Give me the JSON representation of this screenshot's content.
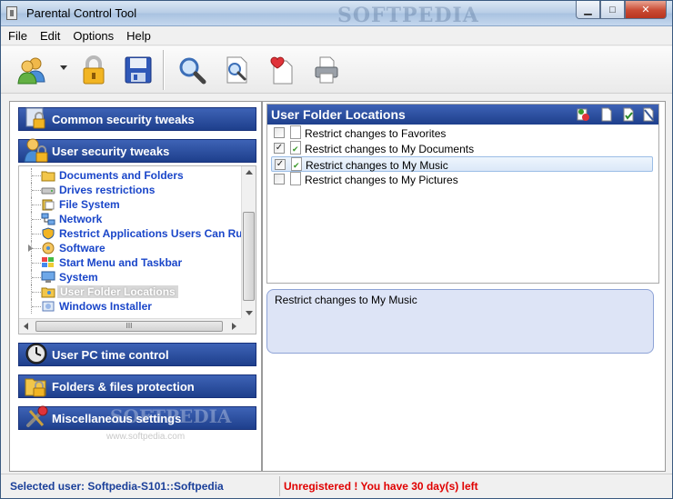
{
  "window": {
    "title": "Parental Control Tool",
    "watermark": "SOFTPEDIA",
    "minimize_glyph": "▁",
    "maximize_glyph": "□",
    "close_glyph": "✕"
  },
  "menu": [
    "File",
    "Edit",
    "Options",
    "Help"
  ],
  "toolbar": {
    "buttons": [
      {
        "icon": "users-icon"
      },
      {
        "icon": "lock-icon"
      },
      {
        "icon": "save-icon"
      },
      {
        "icon": "search-icon"
      },
      {
        "icon": "search-document-icon"
      },
      {
        "icon": "favorite-document-icon"
      },
      {
        "icon": "print-icon"
      }
    ]
  },
  "left_panel": {
    "categories": [
      {
        "label": "Common security tweaks",
        "icon": "lock-icon"
      },
      {
        "label": "User security tweaks",
        "icon": "user-lock-icon"
      },
      {
        "label": "User PC time control",
        "icon": "clock-icon"
      },
      {
        "label": "Folders & files protection",
        "icon": "folder-lock-icon"
      },
      {
        "label": "Miscellaneous settings",
        "icon": "tools-icon"
      }
    ],
    "tree_items": [
      {
        "label": "Documents and Folders",
        "icon": "folder-icon"
      },
      {
        "label": "Drives restrictions",
        "icon": "drive-icon"
      },
      {
        "label": "File System",
        "icon": "file-system-icon"
      },
      {
        "label": "Network",
        "icon": "network-icon"
      },
      {
        "label": "Restrict Applications Users Can Ru",
        "icon": "shield-icon"
      },
      {
        "label": "Software",
        "icon": "software-icon"
      },
      {
        "label": "Start Menu and Taskbar",
        "icon": "start-menu-icon"
      },
      {
        "label": "System",
        "icon": "system-icon"
      },
      {
        "label": "User Folder Locations",
        "icon": "user-folder-icon",
        "selected": true
      },
      {
        "label": "Windows Installer",
        "icon": "installer-icon"
      }
    ],
    "hscroll_grip": "III",
    "watermark": "SOFTPEDIA",
    "watermark_url": "www.softpedia.com"
  },
  "right_panel": {
    "title": "User Folder Locations",
    "header_icons": [
      "add-icon",
      "page-icon",
      "check-all-icon",
      "uncheck-all-icon"
    ],
    "items": [
      {
        "label": "Restrict changes to Favorites",
        "checked": false,
        "doc_checked": false
      },
      {
        "label": "Restrict changes to My Documents",
        "checked": true,
        "doc_checked": true
      },
      {
        "label": "Restrict changes to My Music",
        "checked": true,
        "doc_checked": true,
        "selected": true
      },
      {
        "label": "Restrict changes to My Pictures",
        "checked": false,
        "doc_checked": false
      }
    ],
    "description": "Restrict changes to My Music"
  },
  "status": {
    "selected_user": "Selected user: Softpedia-S101::Softpedia",
    "registration": "Unregistered ! You have 30 day(s) left"
  },
  "colors": {
    "category_bar": "#1e3f8c",
    "link_text": "#1a46c9",
    "status_user": "#1a3f99",
    "status_warning": "#e00000"
  }
}
